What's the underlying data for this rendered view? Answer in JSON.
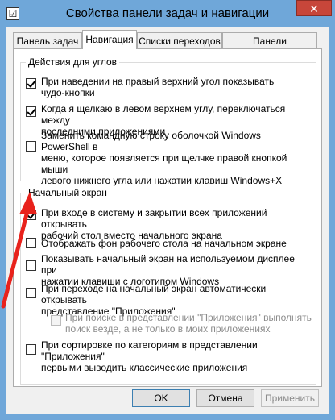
{
  "window": {
    "title": "Свойства панели задач и навигации",
    "close_label": "✕",
    "icon_glyph": "☑"
  },
  "tabs": [
    {
      "label": "Панель задач"
    },
    {
      "label": "Навигация"
    },
    {
      "label": "Списки переходов"
    },
    {
      "label": "Панели инструментов"
    }
  ],
  "corners": {
    "title": "Действия для углов",
    "options": [
      {
        "text_lines": [
          "При наведении на правый верхний угол показывать",
          "чудо-кнопки"
        ],
        "checked": true
      },
      {
        "text_lines": [
          "Когда я щелкаю в левом верхнем углу, переключаться между",
          "последними приложениями"
        ],
        "checked": true
      },
      {
        "text_lines": [
          "Заменить командную строку оболочкой Windows PowerShell в",
          "меню, которое появляется при щелчке правой кнопкой мыши",
          "левого нижнего угла или нажатии клавиш Windows+X"
        ],
        "checked": false
      }
    ]
  },
  "start": {
    "title": "Начальный экран",
    "options": [
      {
        "text_lines": [
          "При входе в систему и закрытии всех приложений открывать",
          "рабочий стол вместо начального экрана"
        ],
        "checked": true,
        "disabled": false
      },
      {
        "text_lines": [
          "Отображать фон рабочего стола на начальном экране"
        ],
        "checked": false,
        "disabled": false
      },
      {
        "text_lines": [
          "Показывать начальный экран на используемом дисплее при",
          "нажатии клавиши с логотипом Windows"
        ],
        "checked": false,
        "disabled": false
      },
      {
        "text_lines": [
          "При переходе на начальный экран автоматически открывать",
          "представление \"Приложения\""
        ],
        "checked": false,
        "disabled": false
      },
      {
        "text_lines": [
          "При поиске в представлении \"Приложения\" выполнять",
          "поиск везде, а не только в моих приложениях"
        ],
        "checked": false,
        "disabled": true
      },
      {
        "text_lines": [
          "При сортировке по категориям в представлении \"Приложения\"",
          "первыми выводить классические приложения"
        ],
        "checked": false,
        "disabled": false
      }
    ]
  },
  "buttons": {
    "ok": "OK",
    "cancel": "Отмена",
    "apply": "Применить"
  },
  "colors": {
    "frame": "#6fa7d9",
    "close": "#c7463a",
    "arrow": "#e8221c"
  }
}
